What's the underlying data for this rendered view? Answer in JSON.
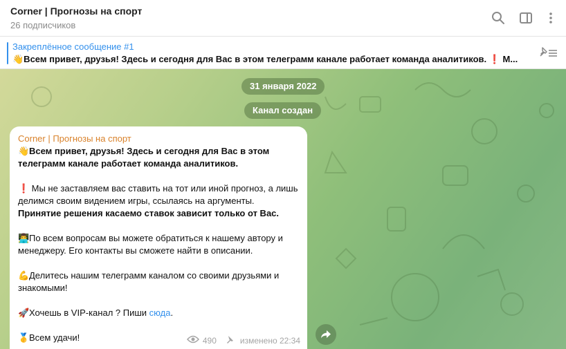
{
  "header": {
    "title": "Corner | Прогнозы на спорт",
    "subscribers": "26 подписчиков",
    "icons": [
      "search-icon",
      "sidebar-toggle-icon",
      "more-vertical-icon"
    ]
  },
  "pinned": {
    "title": "Закреплённое сообщение #1",
    "text": "👋Всем привет, друзья! Здесь и сегодня для Вас в этом телеграмм канале работает команда аналитиков. ❗ М...",
    "icon": "unpin-list-icon"
  },
  "chat": {
    "date_pill": "31 января 2022",
    "service_pill": "Канал создан",
    "message": {
      "author": "Corner | Прогнозы на спорт",
      "p1_emoji": "👋",
      "p1_text": "Всем привет, друзья! Здесь и сегодня для Вас в этом телеграмм канале работает команда аналитиков.",
      "p2_emoji": "❗",
      "p2_text": " Мы не заставляем вас ставить на тот или иной прогноз, а лишь делимся своим видением игры, ссылаясь на аргументы.",
      "p2_bold": "Принятие решения касаемо ставок зависит только от Вас.",
      "p3_emoji": "👨‍💻",
      "p3_text": "По всем вопросам вы можете обратиться к нашему автору и менеджеру. Его контакты вы сможете найти в описании.",
      "p4_emoji": "💪",
      "p4_text": "Делитесь нашим телеграмм каналом со своими друзьями и знакомыми!",
      "p5_emoji": "🚀",
      "p5_text": "Хочешь в VIP-канал ? Пиши ",
      "p5_link": "сюда",
      "p5_end": ".",
      "p6_emoji": "🥇",
      "p6_text": "Всем удачи!",
      "views": "490",
      "status": "изменено 22:34"
    },
    "share_icon": "share-arrow-icon"
  },
  "colors": {
    "accent": "#3390ec",
    "author": "#d9822b",
    "bg_start": "#d3d99a",
    "bg_end": "#7ab27a"
  }
}
